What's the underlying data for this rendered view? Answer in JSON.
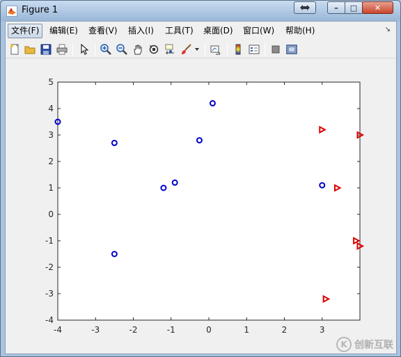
{
  "window": {
    "title": "Figure 1",
    "special_button_icon": "restore-pane-icon",
    "minimize_label": "–",
    "maximize_label": "□",
    "close_label": "✕"
  },
  "menubar": {
    "items": [
      {
        "label": "文件(F)",
        "active": true
      },
      {
        "label": "编辑(E)"
      },
      {
        "label": "查看(V)"
      },
      {
        "label": "插入(I)"
      },
      {
        "label": "工具(T)"
      },
      {
        "label": "桌面(D)"
      },
      {
        "label": "窗口(W)"
      },
      {
        "label": "帮助(H)"
      }
    ],
    "overflow_icon": "chevron-overflow-icon"
  },
  "toolbar": {
    "tools": [
      "new-figure-icon",
      "open-file-icon",
      "save-icon",
      "print-icon",
      "pointer-icon",
      "zoom-in-icon",
      "zoom-out-icon",
      "pan-hand-icon",
      "rotate-3d-icon",
      "data-cursor-icon",
      "brush-icon",
      "dropdown-arrow-icon",
      "link-plot-icon",
      "colorbar-icon",
      "legend-icon",
      "hide-plot-tools-icon",
      "show-plot-tools-icon"
    ]
  },
  "chart_data": {
    "type": "scatter",
    "title": "",
    "xlabel": "",
    "ylabel": "",
    "xlim": [
      -4,
      4
    ],
    "ylim": [
      -4,
      5
    ],
    "xticks": [
      -4,
      -3,
      -2,
      -1,
      0,
      1,
      2,
      3
    ],
    "yticks": [
      -4,
      -3,
      -2,
      -1,
      0,
      1,
      2,
      3,
      4,
      5
    ],
    "grid": false,
    "axes_box": true,
    "series": [
      {
        "marker": "circle",
        "color": "#0000cc",
        "points": [
          [
            -4.0,
            3.5
          ],
          [
            -2.5,
            2.7
          ],
          [
            -2.5,
            -1.5
          ],
          [
            -1.2,
            1.0
          ],
          [
            -0.9,
            1.2
          ],
          [
            -0.25,
            2.8
          ],
          [
            0.1,
            4.2
          ],
          [
            3.0,
            1.1
          ]
        ]
      },
      {
        "marker": "triangle-right",
        "color": "#dd0000",
        "points": [
          [
            3.0,
            3.2
          ],
          [
            4.0,
            3.0
          ],
          [
            3.4,
            1.0
          ],
          [
            3.9,
            -1.0
          ],
          [
            4.0,
            -1.2
          ],
          [
            3.1,
            -3.2
          ]
        ]
      }
    ]
  },
  "watermark": {
    "logo_text": "K",
    "text": "创新互联"
  }
}
